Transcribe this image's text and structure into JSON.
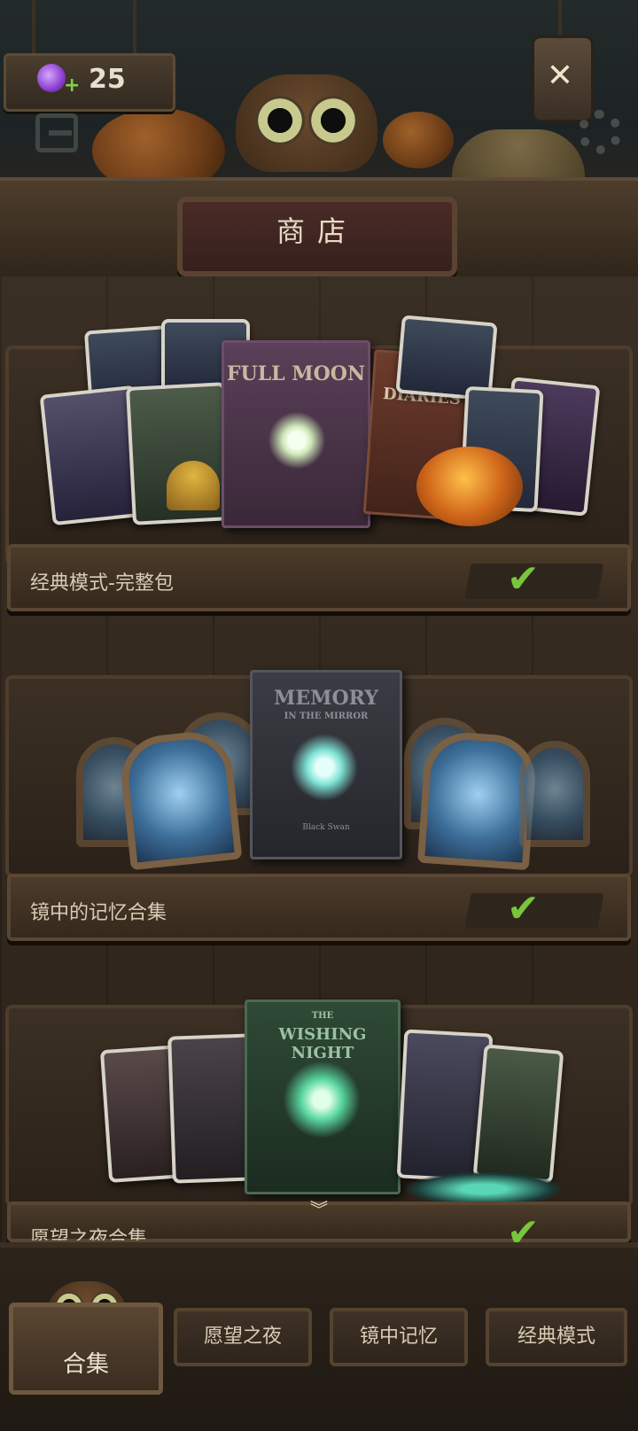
{
  "header": {
    "title": "商店",
    "currency_value": "25",
    "currency_icon": "candy-icon",
    "close_icon": "close-icon",
    "exit_icon": "exit-icon",
    "settings_icon": "gear-icon"
  },
  "shelves": [
    {
      "label": "经典模式-完整包",
      "book_title": "FULL MOON",
      "book_subtitle": "",
      "side_book_title": "DIARIES",
      "owned": true
    },
    {
      "label": "镜中的记忆合集",
      "book_title": "MEMORY",
      "book_subtitle": "IN THE MIRROR",
      "book_footer": "Black Swan",
      "owned": true
    },
    {
      "label": "愿望之夜合集",
      "book_title": "WISHING NIGHT",
      "book_subtitle": "THE",
      "owned": true
    }
  ],
  "nav": {
    "items": [
      {
        "label": "合集",
        "active": true
      },
      {
        "label": "愿望之夜",
        "active": false
      },
      {
        "label": "镜中记忆",
        "active": false
      },
      {
        "label": "经典模式",
        "active": false
      }
    ]
  },
  "colors": {
    "accent_check": "#78c63c",
    "plaque": "#4a2b27",
    "wood": "#4b3b2a"
  }
}
